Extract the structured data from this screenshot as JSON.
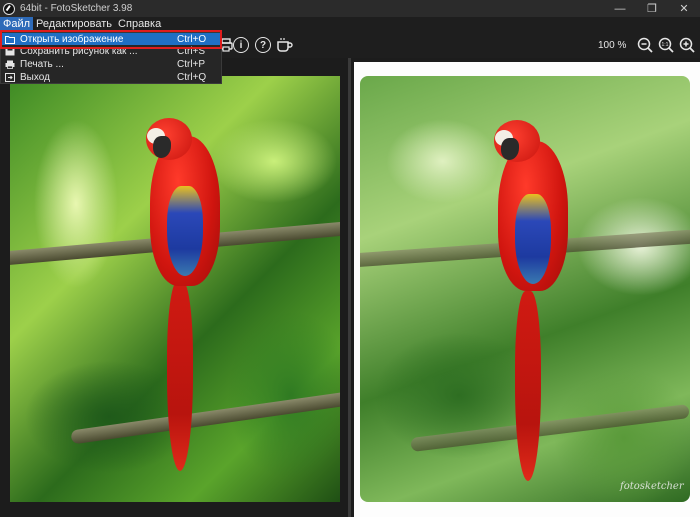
{
  "window": {
    "title": "64bit - FotoSketcher 3.98",
    "minimize": "—",
    "maximize": "❐",
    "close": "✕"
  },
  "menubar": {
    "items": [
      {
        "label": "Файл"
      },
      {
        "label": "Редактировать"
      },
      {
        "label": "Справка"
      }
    ]
  },
  "file_menu": {
    "items": [
      {
        "label": "Открыть изображение",
        "shortcut": "Ctrl+O",
        "icon": "folder-icon"
      },
      {
        "label": "Сохранить рисунок как ...",
        "shortcut": "Ctrl+S",
        "icon": "save-icon"
      },
      {
        "label": "Печать ...",
        "shortcut": "Ctrl+P",
        "icon": "printer-icon"
      },
      {
        "label": "Выход",
        "shortcut": "Ctrl+Q",
        "icon": "exit-icon"
      }
    ]
  },
  "toolbar": {
    "info_glyph": "i",
    "help_glyph": "?",
    "zoom_value": "100 %",
    "zoom_out_glyph": "−",
    "zoom_fit_glyph": "1:1",
    "zoom_in_glyph": "+"
  },
  "canvas": {
    "signature": "fotosketcher"
  },
  "colors": {
    "background": "#1e1e1e",
    "menu_highlight": "#1f6fc4",
    "highlight_frame": "#e01c1c"
  }
}
